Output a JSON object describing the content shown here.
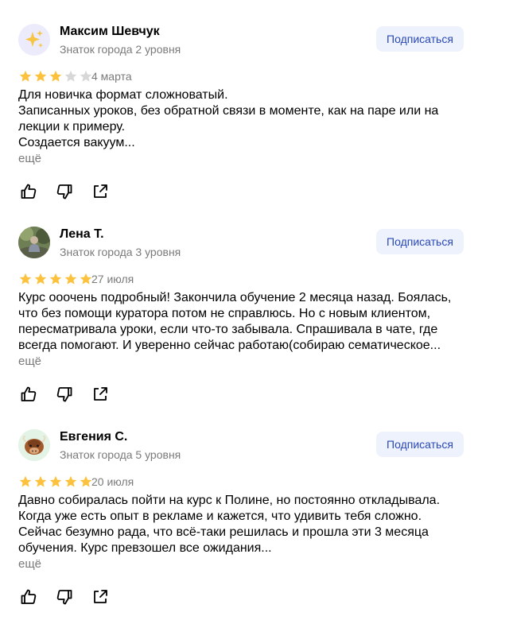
{
  "reviews": [
    {
      "author": "Максим Шевчук",
      "level": "Знаток города 2 уровня",
      "subscribe_label": "Подписаться",
      "rating": 3,
      "max_rating": 5,
      "date": "4 марта",
      "text_lines": [
        "Для новичка формат сложноватый.",
        "Записанных уроков, без обратной связи в моменте, как на паре или на",
        "лекции к примеру.",
        "Создается вакуум..."
      ],
      "more_label": "ещё",
      "avatar_icon": "sparkles-icon",
      "avatar_bg": "#ecebfb"
    },
    {
      "author": "Лена Т.",
      "level": "Знаток города 3 уровня",
      "subscribe_label": "Подписаться",
      "rating": 5,
      "max_rating": 5,
      "date": "27 июля",
      "text_lines": [
        "Курс ооочень подробный! Закончила обучение 2 месяца назад. Боялась,",
        "что без помощи куратора потом не справлюсь. Но с новым клиентом,",
        "пересматривала уроки, если что-то забывала. Спрашивала в чате, где",
        "всегда помогают. И уверенно сейчас работаю(собираю сематическое..."
      ],
      "more_label": "ещё",
      "avatar_icon": "user-photo-avatar",
      "avatar_bg": "#6f7f55"
    },
    {
      "author": "Евгения С.",
      "level": "Знаток города 5 уровня",
      "subscribe_label": "Подписаться",
      "rating": 5,
      "max_rating": 5,
      "date": "20 июля",
      "text_lines": [
        "Давно собиралась пойти на курс к Полине, но постоянно откладывала.",
        "Когда уже есть опыт в рекламе и кажется, что удивить тебя сложно.",
        "Сейчас безумно рада, что всё-таки решилась и прошла эти 3 месяца",
        "обучения. Курс превзошел все ожидания..."
      ],
      "more_label": "ещё",
      "avatar_icon": "yak-icon",
      "avatar_bg": "#e3f3e6"
    }
  ],
  "colors": {
    "star_filled": "#fcc23d",
    "star_empty": "#d7d7d7",
    "subscribe_bg": "#eef2fc",
    "subscribe_text": "#2a49b8",
    "muted_text": "#7a7a7a"
  },
  "action_icons": [
    "thumbs-up-icon",
    "thumbs-down-icon",
    "share-icon"
  ]
}
